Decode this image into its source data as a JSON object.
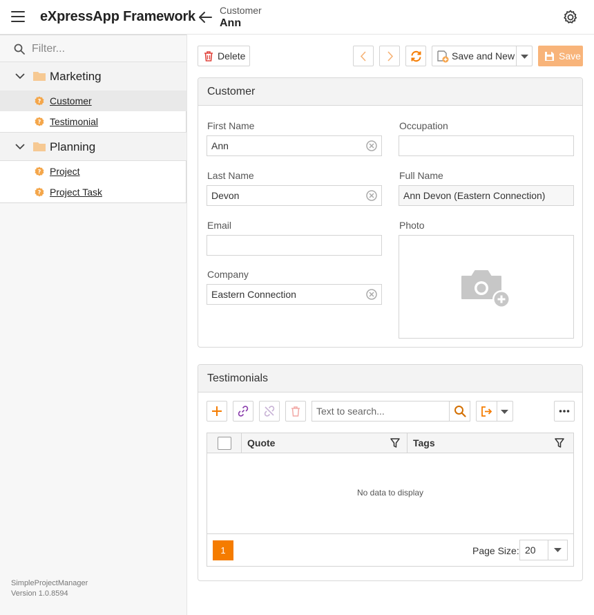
{
  "header": {
    "app_title": "eXpressApp Framework",
    "breadcrumb_type": "Customer",
    "breadcrumb_object": "Ann"
  },
  "sidebar": {
    "filter_placeholder": "Filter...",
    "groups": [
      {
        "label": "Marketing",
        "items": [
          {
            "label": "Customer",
            "selected": true
          },
          {
            "label": "Testimonial"
          }
        ]
      },
      {
        "label": "Planning",
        "items": [
          {
            "label": "Project"
          },
          {
            "label": "Project Task"
          }
        ]
      }
    ],
    "app_name": "SimpleProjectManager",
    "version": "Version 1.0.8594"
  },
  "toolbar": {
    "delete_label": "Delete",
    "save_and_new_label": "Save and New",
    "save_label": "Save"
  },
  "customer_panel": {
    "title": "Customer",
    "first_name": {
      "label": "First Name",
      "value": "Ann"
    },
    "last_name": {
      "label": "Last Name",
      "value": "Devon"
    },
    "email": {
      "label": "Email",
      "value": ""
    },
    "company": {
      "label": "Company",
      "value": "Eastern Connection"
    },
    "occupation": {
      "label": "Occupation",
      "value": ""
    },
    "full_name": {
      "label": "Full Name",
      "value": "Ann Devon (Eastern Connection)"
    },
    "photo": {
      "label": "Photo"
    }
  },
  "testimonials_panel": {
    "title": "Testimonials",
    "search_placeholder": "Text to search...",
    "columns": [
      "Quote",
      "Tags"
    ],
    "no_data": "No data to display",
    "current_page": "1",
    "page_size_label": "Page Size:",
    "page_size": "20"
  },
  "colors": {
    "accent": "#f57c00",
    "save_disabled": "#f8b47a",
    "folder": "#f6c993"
  }
}
